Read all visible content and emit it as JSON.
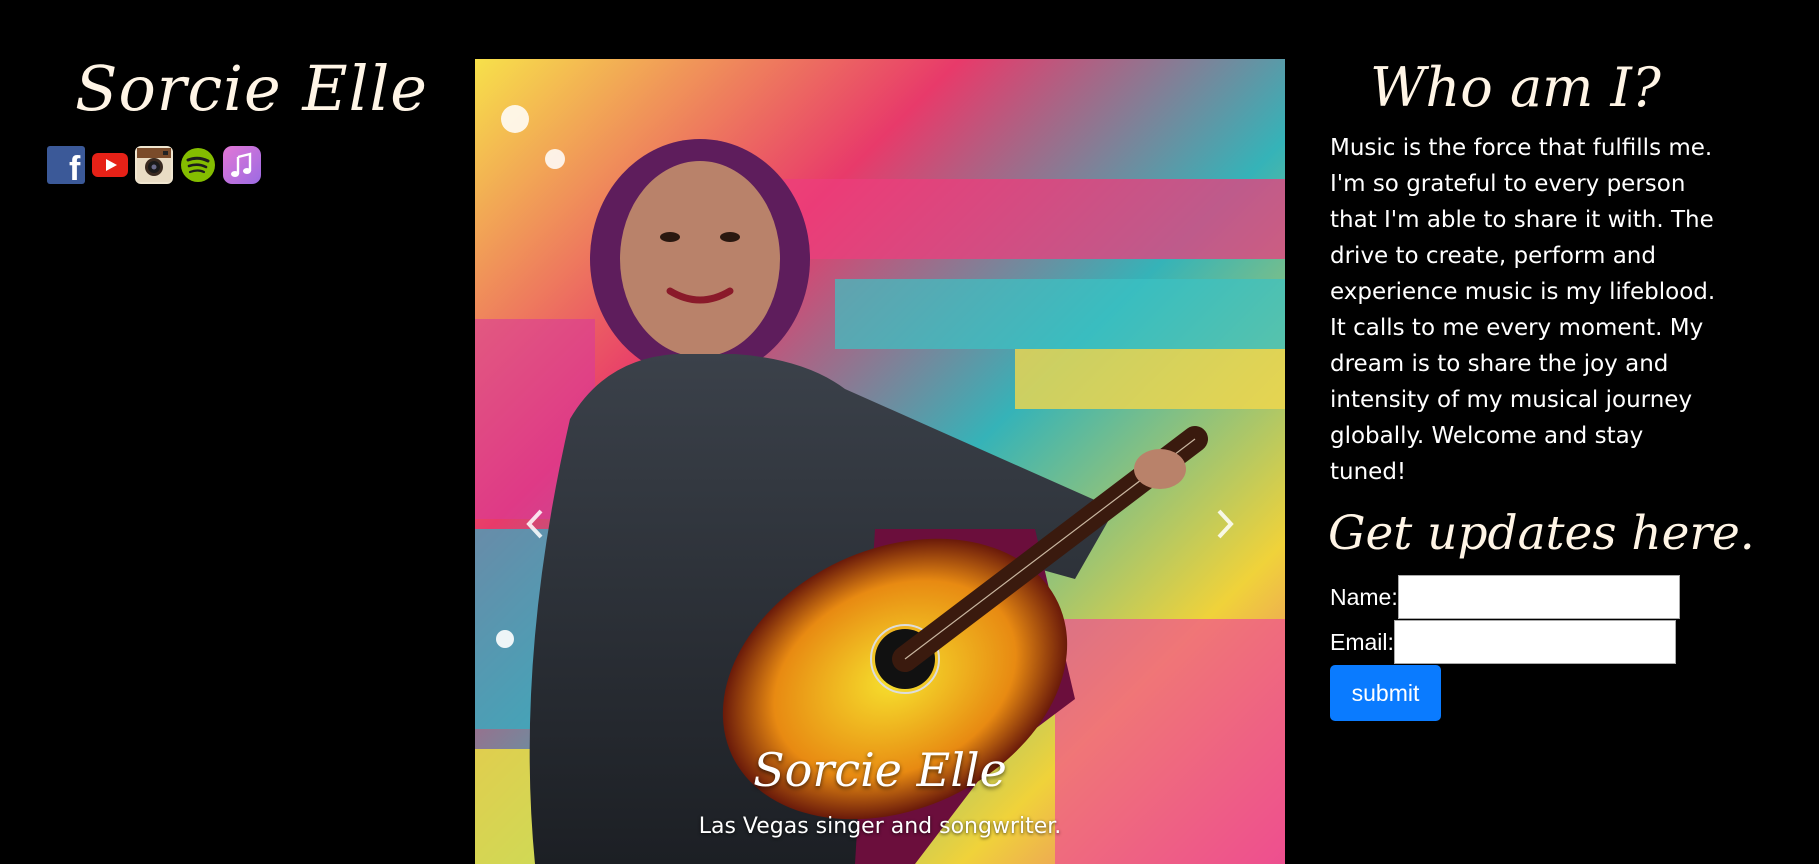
{
  "site": {
    "name": "Sorcie Elle"
  },
  "social_links": [
    {
      "icon": "facebook-icon"
    },
    {
      "icon": "youtube-icon"
    },
    {
      "icon": "instagram-icon"
    },
    {
      "icon": "spotify-icon"
    },
    {
      "icon": "itunes-icon"
    }
  ],
  "carousel": {
    "caption_title": "Sorcie Elle",
    "caption_subtitle": "Las Vegas singer and songwriter.",
    "slide_count": 4,
    "active_slide": 0,
    "prev_icon": "chevron-left-icon",
    "next_icon": "chevron-right-icon"
  },
  "about": {
    "title": "Who am I?",
    "body": "Music is the force that fulfills me. I'm so grateful to every person that I'm able to share it with. The drive to create, perform and experience music is my lifeblood. It calls to me every moment. My dream is to share the joy and intensity of my musical journey globally. Welcome and stay tuned!"
  },
  "signup": {
    "title": "Get updates here.",
    "name_label": "Name:",
    "name_value": "",
    "email_label": "Email:",
    "email_value": "",
    "submit_label": "submit"
  },
  "colors": {
    "background": "#000000",
    "heading": "#fff5e6",
    "button": "#0a7bff"
  }
}
